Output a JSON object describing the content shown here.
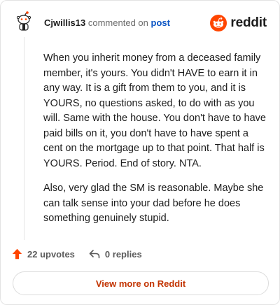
{
  "header": {
    "username": "Cjwillis13",
    "commented_text": "commented on",
    "post_link": "post",
    "brand_name": "reddit",
    "brand_color": "#ff4500"
  },
  "avatar": {
    "icon": "snoo-avatar-icon"
  },
  "comment": {
    "paragraphs": [
      "When you inherit money from a deceased family member, it's yours. You didn't HAVE to earn it in any way. It is a gift from them to you, and it is YOURS, no questions asked, to do with as you will. Same with the house. You don't have to have paid bills on it, you don't have to have spent a cent on the mortgage up to that point. That half is YOURS. Period. End of story. NTA.",
      "Also, very glad the SM is reasonable. Maybe she can talk sense into your dad before he does something genuinely stupid."
    ]
  },
  "actions": {
    "upvotes": "22 upvotes",
    "replies": "0 replies",
    "upvote_color": "#ff4500"
  },
  "footer": {
    "view_more": "View more on Reddit",
    "view_more_color": "#c23300"
  }
}
